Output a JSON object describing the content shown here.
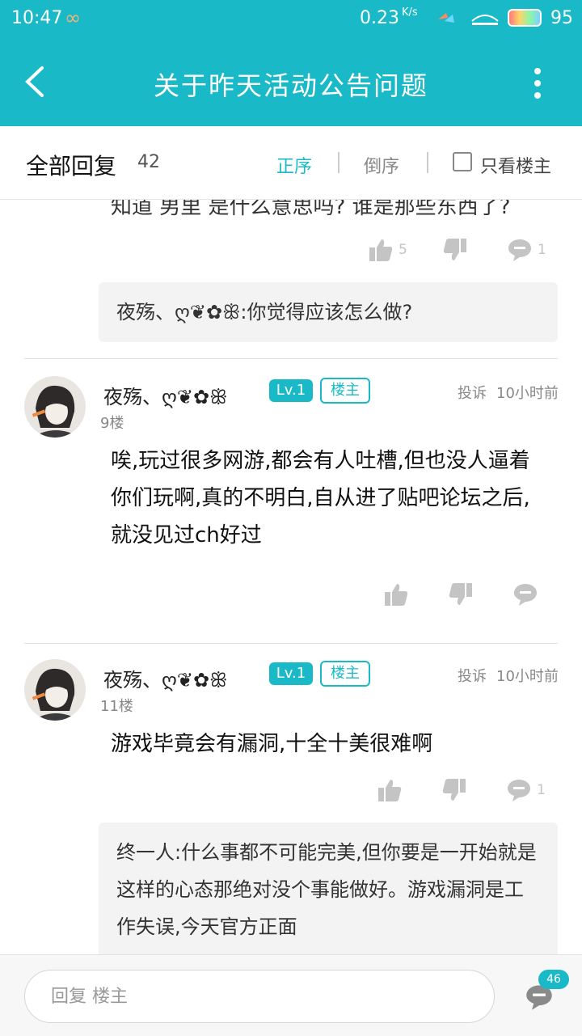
{
  "statusbar": {
    "time": "10:47",
    "infinity": "∞",
    "net_speed": "0.23",
    "net_unit": "K/s",
    "battery": "95"
  },
  "appbar": {
    "title": "关于昨天活动公告问题"
  },
  "filter": {
    "all_replies_label": "全部回复",
    "count": "42",
    "ascending": "正序",
    "descending": "倒序",
    "owner_only": "只看楼主"
  },
  "top_fragment": {
    "cut_text": "知道 男里 是什么意思吗? 谁是那些东西了?",
    "like_count": "5",
    "comment_count": "1",
    "quote_user": "夜殇、ღ❦✿ꕥ",
    "quote_text": ":你觉得应该怎么做?"
  },
  "posts": [
    {
      "username": "夜殇、ღ❦✿ꕥ",
      "level": "Lv.1",
      "owner_tag": "楼主",
      "report": "投诉",
      "time": "10小时前",
      "floor": "9楼",
      "text": "唉,玩过很多网游,都会有人吐槽,但也没人逼着你们玩啊,真的不明白,自从进了贴吧论坛之后,就没见过ch好过"
    },
    {
      "username": "夜殇、ღ❦✿ꕥ",
      "level": "Lv.1",
      "owner_tag": "楼主",
      "report": "投诉",
      "time": "10小时前",
      "floor": "11楼",
      "text": "游戏毕竟会有漏洞,十全十美很难啊",
      "comment_count": "1",
      "quote_user": "终一人",
      "quote_text": ":什么事都不可能完美,但你要是一开始就是这样的心态那绝对没个事能做好。游戏漏洞是工作失误,今天官方正面"
    }
  ],
  "bottombar": {
    "placeholder": "回复 楼主",
    "badge": "46"
  },
  "colors": {
    "accent": "#1ab9c7",
    "icon_grey": "#c4c4c4"
  }
}
